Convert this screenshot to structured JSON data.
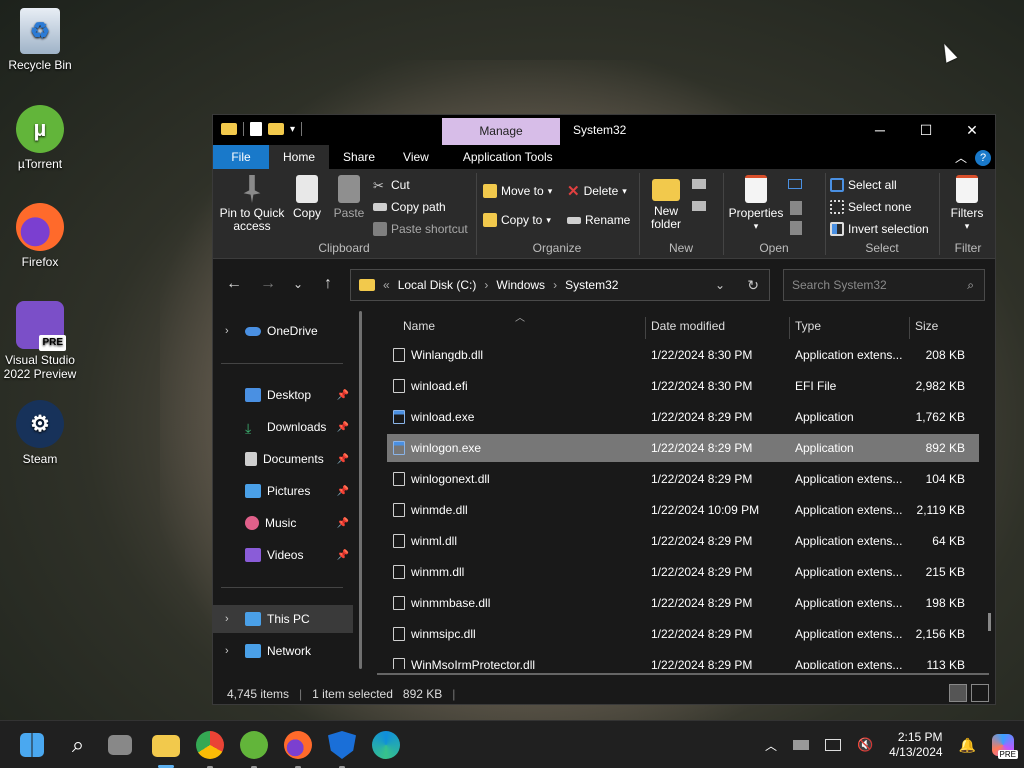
{
  "desktop": {
    "icons": [
      {
        "label": "Recycle Bin",
        "icon": "recycle-bin-icon"
      },
      {
        "label": "µTorrent",
        "icon": "utorrent-icon"
      },
      {
        "label": "Firefox",
        "icon": "firefox-icon"
      },
      {
        "label": "Visual Studio 2022 Preview",
        "icon": "visual-studio-icon",
        "badge": "PRE"
      },
      {
        "label": "Steam",
        "icon": "steam-icon"
      }
    ]
  },
  "window": {
    "manage_tab": "Manage",
    "title": "System32",
    "controls": {
      "minimize": "─",
      "maximize": "☐",
      "close": "✕"
    },
    "ribbon_tabs": [
      "File",
      "Home",
      "Share",
      "View",
      "Application Tools"
    ],
    "ribbon": {
      "clipboard": {
        "label": "Clipboard",
        "pin": "Pin to Quick access",
        "copy": "Copy",
        "paste": "Paste",
        "cut": "Cut",
        "copy_path": "Copy path",
        "paste_shortcut": "Paste shortcut"
      },
      "organize": {
        "label": "Organize",
        "move_to": "Move to",
        "copy_to": "Copy to",
        "delete": "Delete",
        "rename": "Rename"
      },
      "new": {
        "label": "New",
        "new_folder": "New folder"
      },
      "open": {
        "label": "Open",
        "properties": "Properties"
      },
      "select": {
        "label": "Select",
        "select_all": "Select all",
        "select_none": "Select none",
        "invert": "Invert selection"
      },
      "filter": {
        "label": "Filter",
        "filters": "Filters"
      }
    },
    "address": {
      "prefix": "«",
      "crumbs": [
        "Local Disk (C:)",
        "Windows",
        "System32"
      ],
      "search_placeholder": "Search System32"
    },
    "nav_pane": {
      "onedrive": "OneDrive",
      "quick": [
        "Desktop",
        "Downloads",
        "Documents",
        "Pictures",
        "Music",
        "Videos"
      ],
      "this_pc": "This PC",
      "network": "Network"
    },
    "columns": {
      "name": "Name",
      "date": "Date modified",
      "type": "Type",
      "size": "Size"
    },
    "files": [
      {
        "name": "Winlangdb.dll",
        "date": "1/22/2024 8:30 PM",
        "type": "Application extens...",
        "size": "208 KB",
        "kind": "dll"
      },
      {
        "name": "winload.efi",
        "date": "1/22/2024 8:30 PM",
        "type": "EFI File",
        "size": "2,982 KB",
        "kind": "file"
      },
      {
        "name": "winload.exe",
        "date": "1/22/2024 8:29 PM",
        "type": "Application",
        "size": "1,762 KB",
        "kind": "exe"
      },
      {
        "name": "winlogon.exe",
        "date": "1/22/2024 8:29 PM",
        "type": "Application",
        "size": "892 KB",
        "kind": "exe",
        "selected": true
      },
      {
        "name": "winlogonext.dll",
        "date": "1/22/2024 8:29 PM",
        "type": "Application extens...",
        "size": "104 KB",
        "kind": "dll"
      },
      {
        "name": "winmde.dll",
        "date": "1/22/2024 10:09 PM",
        "type": "Application extens...",
        "size": "2,119 KB",
        "kind": "dll"
      },
      {
        "name": "winml.dll",
        "date": "1/22/2024 8:29 PM",
        "type": "Application extens...",
        "size": "64 KB",
        "kind": "dll"
      },
      {
        "name": "winmm.dll",
        "date": "1/22/2024 8:29 PM",
        "type": "Application extens...",
        "size": "215 KB",
        "kind": "dll"
      },
      {
        "name": "winmmbase.dll",
        "date": "1/22/2024 8:29 PM",
        "type": "Application extens...",
        "size": "198 KB",
        "kind": "dll"
      },
      {
        "name": "winmsipc.dll",
        "date": "1/22/2024 8:29 PM",
        "type": "Application extens...",
        "size": "2,156 KB",
        "kind": "dll"
      },
      {
        "name": "WinMsoIrmProtector.dll",
        "date": "1/22/2024 8:29 PM",
        "type": "Application extens...",
        "size": "113 KB",
        "kind": "dll"
      }
    ],
    "status": {
      "items": "4,745 items",
      "selected": "1 item selected",
      "size": "892 KB"
    }
  },
  "taskbar": {
    "apps": [
      "start-icon",
      "search-icon",
      "task-view-icon",
      "file-explorer-icon",
      "chrome-icon",
      "utorrent-icon",
      "firefox-icon",
      "defender-icon",
      "edge-icon"
    ],
    "time": "2:15 PM",
    "date": "4/13/2024",
    "copilot_badge": "PRE"
  },
  "colors": {
    "accent": "#1979ca",
    "manage": "#d7bde8",
    "selected_row": "#777777"
  }
}
